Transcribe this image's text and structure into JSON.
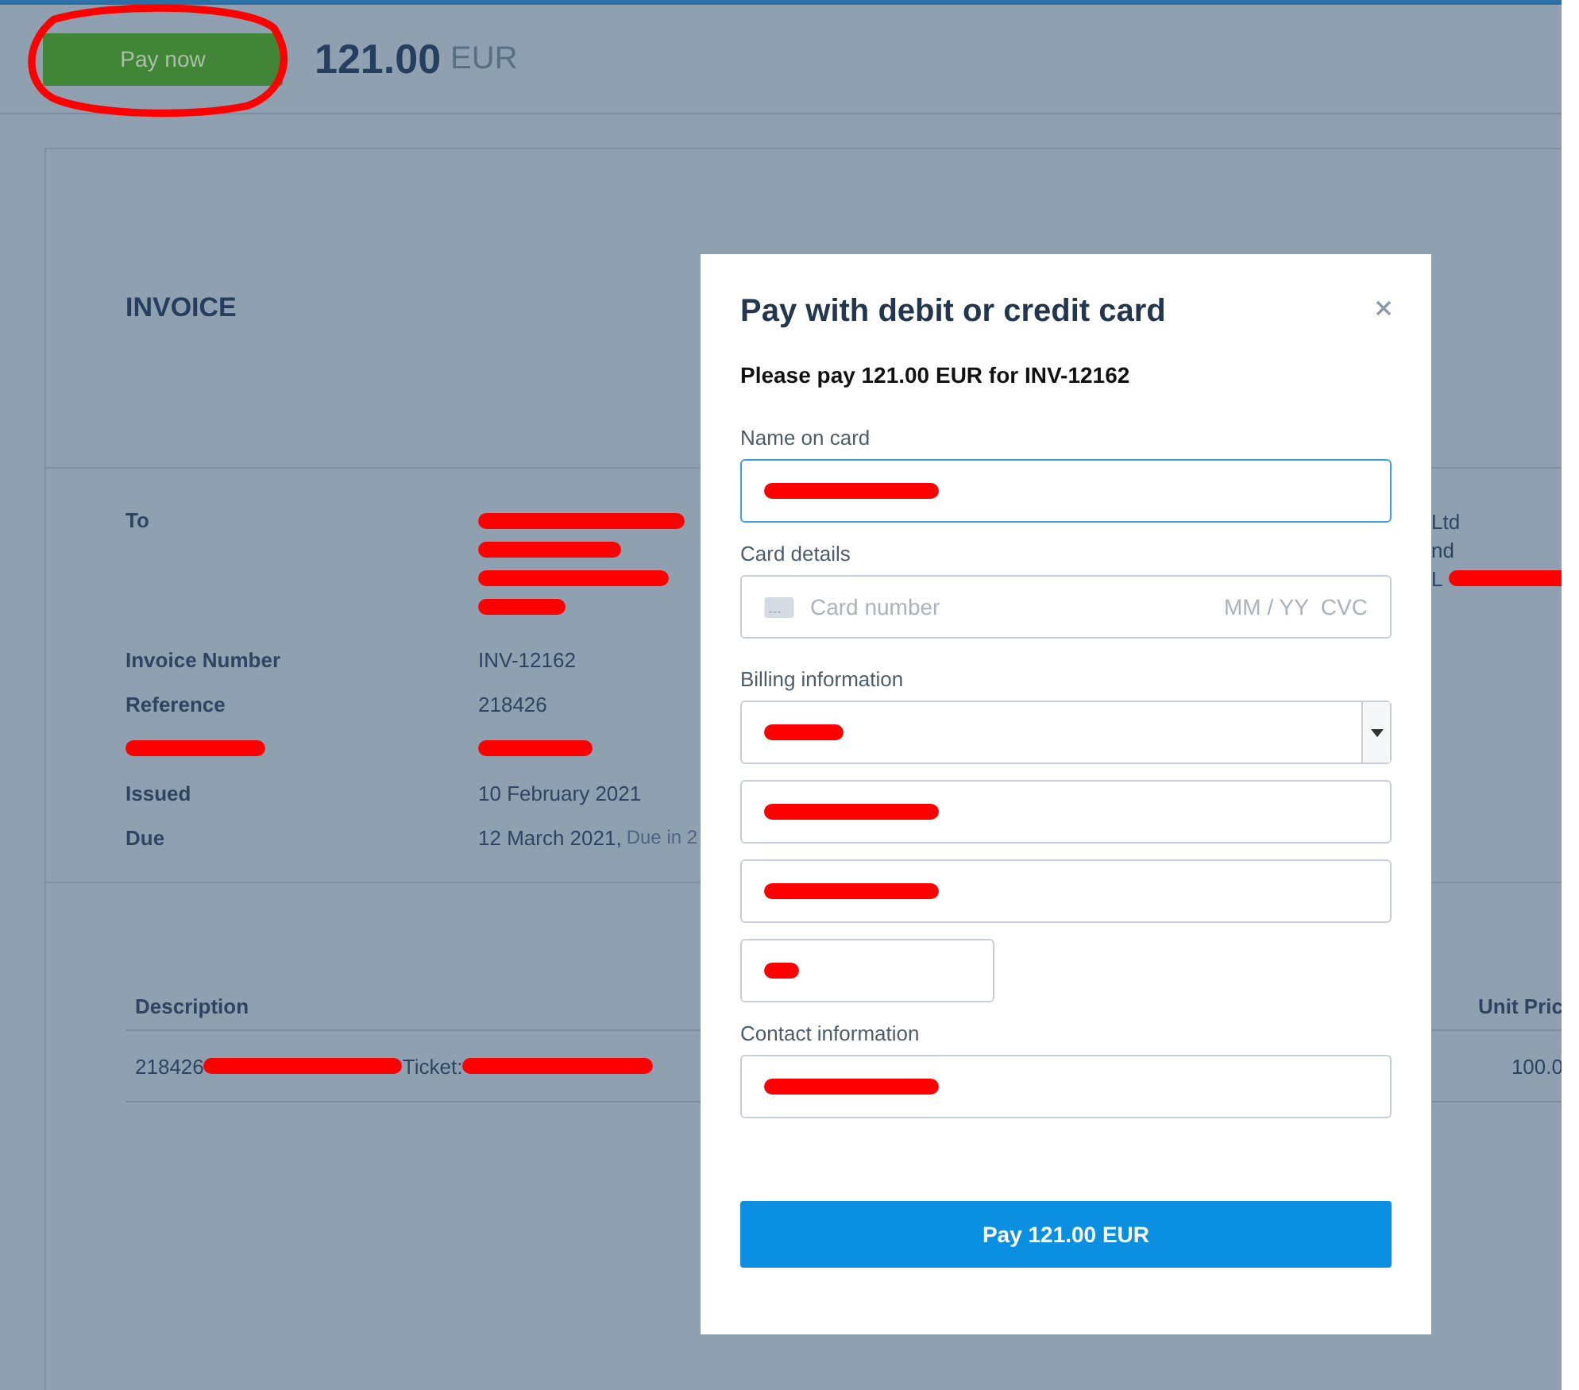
{
  "header": {
    "pay_button": {
      "label": "Pay now",
      "circled": true
    },
    "amount": "121.00",
    "currency": "EUR"
  },
  "invoice": {
    "title": "INVOICE",
    "recipient": {
      "label": "To",
      "lines": [
        {
          "redacted": true
        },
        {
          "redacted": true
        },
        {
          "redacted": true
        },
        {
          "redacted": true
        }
      ]
    },
    "details": [
      {
        "label": "Invoice Number",
        "value": "INV-12162"
      },
      {
        "label": "Reference",
        "value": "218426"
      },
      {
        "label_redacted": true,
        "value_redacted": true
      },
      {
        "label": "Issued",
        "value": "10 February 2021"
      },
      {
        "label": "Due",
        "value": "12 March 2021,",
        "note": "Due in 2"
      }
    ],
    "sender_lines": [
      {
        "text": "Ltd"
      },
      {
        "text": "nd"
      },
      {
        "text": "L",
        "redacted": true
      }
    ],
    "table": {
      "columns": [
        "Description",
        "Unit Pric"
      ],
      "rows": [
        {
          "description": [
            {
              "text": "218426"
            },
            {
              "redacted": true
            },
            {
              "text": "Ticket:"
            },
            {
              "redacted": true
            }
          ],
          "unit_price": "100.0"
        }
      ]
    }
  },
  "modal": {
    "title": "Pay with debit or credit card",
    "subtitle": "Please pay 121.00 EUR for INV-12162",
    "fields": [
      {
        "kind": "label",
        "text": "Name on card"
      },
      {
        "kind": "input",
        "focused": true,
        "redacted": true
      },
      {
        "kind": "label",
        "text": "Card details"
      },
      {
        "kind": "card",
        "placeholder": "Card number",
        "extra": "MM / YY  CVC"
      },
      {
        "kind": "label",
        "text": "Billing information"
      },
      {
        "kind": "select",
        "redacted": true
      },
      {
        "kind": "input",
        "focused": false,
        "redacted": true
      },
      {
        "kind": "input",
        "focused": false,
        "redacted": true
      },
      {
        "kind": "short",
        "redacted": true
      },
      {
        "kind": "label",
        "text": "Contact information"
      },
      {
        "kind": "input",
        "focused": false,
        "redacted": true
      }
    ],
    "pay_button": "Pay 121.00 EUR"
  }
}
